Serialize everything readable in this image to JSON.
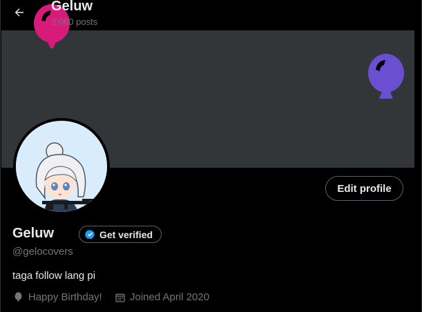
{
  "header": {
    "title": "Geluw",
    "posts_count": "3,060 posts"
  },
  "profile": {
    "display_name": "Geluw",
    "verify_label": "Get verified",
    "handle": "@gelocovers",
    "bio": "taga follow lang pi",
    "edit_label": "Edit profile",
    "birthday": "Happy Birthday!",
    "joined": "Joined April 2020"
  },
  "colors": {
    "balloon_pink": "#d81b7a",
    "balloon_purple": "#6a4fd1",
    "banner": "#333639",
    "verify_blue": "#1d9bf0"
  },
  "icons": {
    "back": "arrow-left-icon",
    "verified": "verified-badge-icon",
    "birthday": "balloon-icon",
    "calendar": "calendar-icon"
  }
}
